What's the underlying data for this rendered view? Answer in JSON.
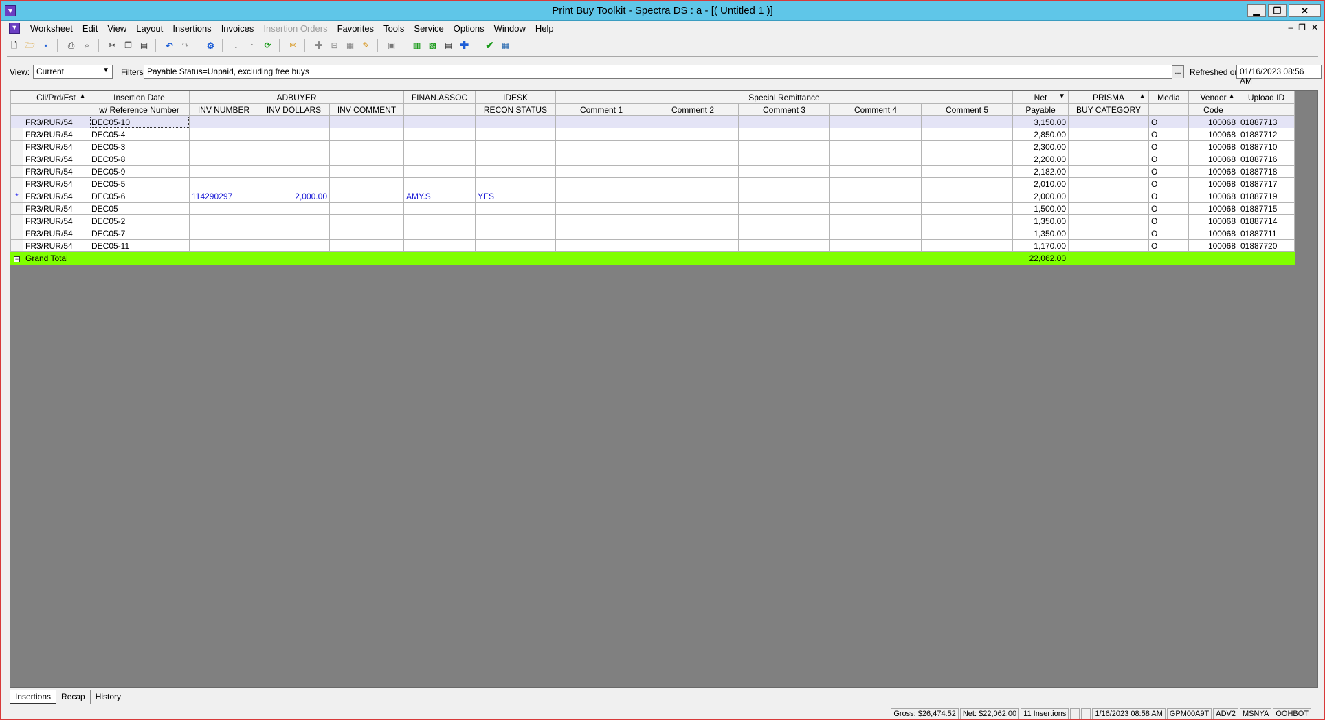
{
  "window": {
    "title": "Print Buy Toolkit - Spectra DS : a - [( Untitled 1 )]",
    "app_icon": "shopping-cart-icon",
    "minimize": "▁",
    "restore": "❐",
    "close": "✕"
  },
  "menu": {
    "items": [
      "Worksheet",
      "Edit",
      "View",
      "Layout",
      "Insertions",
      "Invoices",
      "Insertion Orders",
      "Favorites",
      "Tools",
      "Service",
      "Options",
      "Window",
      "Help"
    ],
    "disabled_index": 6,
    "mdi_minimize": "–",
    "mdi_restore": "❐",
    "mdi_close": "✕"
  },
  "filters": {
    "view_label": "View:",
    "view_value": "Current",
    "filters_label": "Filters:",
    "filters_value": "Payable Status=Unpaid, excluding free buys",
    "ellipsis": "...",
    "refreshed_label": "Refreshed on:",
    "refreshed_value": "01/16/2023 08:56 AM"
  },
  "grid": {
    "header_top": {
      "cli": "Cli/Prd/Est",
      "insertion_date": "Insertion Date",
      "adbuyer": "ADBUYER",
      "finan": "FINAN.ASSOC",
      "idesk": "IDESK",
      "special": "Special Remittance",
      "net": "Net",
      "prisma": "PRISMA",
      "media": "Media",
      "vendor": "Vendor",
      "upload": "Upload ID"
    },
    "header_bottom": {
      "ref": "w/ Reference Number",
      "inv_number": "INV NUMBER",
      "inv_dollars": "INV DOLLARS",
      "inv_comment": "INV COMMENT",
      "recon": "RECON STATUS",
      "c1": "Comment 1",
      "c2": "Comment 2",
      "c3": "Comment 3",
      "c4": "Comment 4",
      "c5": "Comment 5",
      "payable": "Payable",
      "buy_category": "BUY CATEGORY",
      "code": "Code"
    },
    "rows": [
      {
        "marker": "",
        "cli": "FR3/RUR/54",
        "ref": "DEC05-10",
        "inv_number": "",
        "inv_dollars": "",
        "inv_comment": "",
        "finan": "",
        "recon": "",
        "net": "3,150.00",
        "media": "O",
        "vendor": "100068",
        "upload": "01887713"
      },
      {
        "marker": "",
        "cli": "FR3/RUR/54",
        "ref": "DEC05-4",
        "inv_number": "",
        "inv_dollars": "",
        "inv_comment": "",
        "finan": "",
        "recon": "",
        "net": "2,850.00",
        "media": "O",
        "vendor": "100068",
        "upload": "01887712"
      },
      {
        "marker": "",
        "cli": "FR3/RUR/54",
        "ref": "DEC05-3",
        "inv_number": "",
        "inv_dollars": "",
        "inv_comment": "",
        "finan": "",
        "recon": "",
        "net": "2,300.00",
        "media": "O",
        "vendor": "100068",
        "upload": "01887710"
      },
      {
        "marker": "",
        "cli": "FR3/RUR/54",
        "ref": "DEC05-8",
        "inv_number": "",
        "inv_dollars": "",
        "inv_comment": "",
        "finan": "",
        "recon": "",
        "net": "2,200.00",
        "media": "O",
        "vendor": "100068",
        "upload": "01887716"
      },
      {
        "marker": "",
        "cli": "FR3/RUR/54",
        "ref": "DEC05-9",
        "inv_number": "",
        "inv_dollars": "",
        "inv_comment": "",
        "finan": "",
        "recon": "",
        "net": "2,182.00",
        "media": "O",
        "vendor": "100068",
        "upload": "01887718"
      },
      {
        "marker": "",
        "cli": "FR3/RUR/54",
        "ref": "DEC05-5",
        "inv_number": "",
        "inv_dollars": "",
        "inv_comment": "",
        "finan": "",
        "recon": "",
        "net": "2,010.00",
        "media": "O",
        "vendor": "100068",
        "upload": "01887717"
      },
      {
        "marker": "*",
        "cli": "FR3/RUR/54",
        "ref": "DEC05-6",
        "inv_number": "114290297",
        "inv_dollars": "2,000.00",
        "inv_comment": "",
        "finan": "AMY.S",
        "recon": "YES",
        "net": "2,000.00",
        "media": "O",
        "vendor": "100068",
        "upload": "01887719"
      },
      {
        "marker": "",
        "cli": "FR3/RUR/54",
        "ref": "DEC05",
        "inv_number": "",
        "inv_dollars": "",
        "inv_comment": "",
        "finan": "",
        "recon": "",
        "net": "1,500.00",
        "media": "O",
        "vendor": "100068",
        "upload": "01887715"
      },
      {
        "marker": "",
        "cli": "FR3/RUR/54",
        "ref": "DEC05-2",
        "inv_number": "",
        "inv_dollars": "",
        "inv_comment": "",
        "finan": "",
        "recon": "",
        "net": "1,350.00",
        "media": "O",
        "vendor": "100068",
        "upload": "01887714"
      },
      {
        "marker": "",
        "cli": "FR3/RUR/54",
        "ref": "DEC05-7",
        "inv_number": "",
        "inv_dollars": "",
        "inv_comment": "",
        "finan": "",
        "recon": "",
        "net": "1,350.00",
        "media": "O",
        "vendor": "100068",
        "upload": "01887711"
      },
      {
        "marker": "",
        "cli": "FR3/RUR/54",
        "ref": "DEC05-11",
        "inv_number": "",
        "inv_dollars": "",
        "inv_comment": "",
        "finan": "",
        "recon": "",
        "net": "1,170.00",
        "media": "O",
        "vendor": "100068",
        "upload": "01887720"
      }
    ],
    "total": {
      "expander": "−",
      "label": "Grand Total",
      "net": "22,062.00"
    },
    "total_color": "#80ff00",
    "selected_row_index": 0
  },
  "tabs": [
    "Insertions",
    "Recap",
    "History"
  ],
  "active_tab_index": 0,
  "status": {
    "gross": "Gross: $26,474.52",
    "net": "Net: $22,062.00",
    "insertions": "11 Insertions",
    "date": "1/16/2023  08:58 AM",
    "user": "GPM00A9T",
    "env": "ADV2",
    "org": "MSNYA",
    "agency": "OOHBOT"
  }
}
